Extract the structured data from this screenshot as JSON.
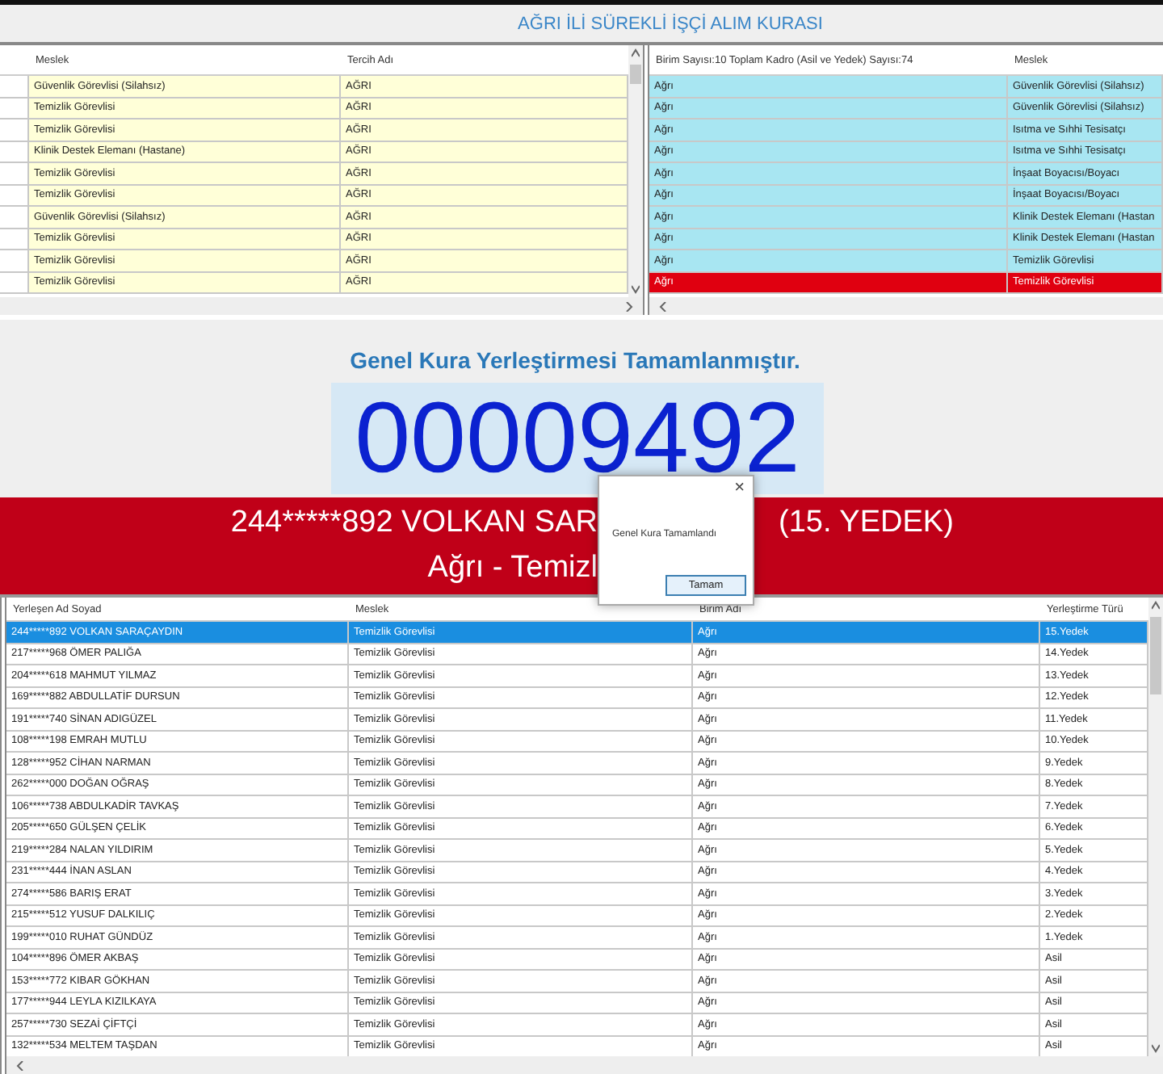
{
  "title": "AĞRI İLİ SÜREKLİ İŞÇİ ALIM KURASI",
  "preference_table": {
    "columns": [
      "Meslek",
      "Tercih Adı"
    ],
    "rows": [
      {
        "meslek": "Güvenlik Görevlisi (Silahsız)",
        "tercih": "AĞRI"
      },
      {
        "meslek": "Temizlik Görevlisi",
        "tercih": "AĞRI"
      },
      {
        "meslek": "Temizlik Görevlisi",
        "tercih": "AĞRI"
      },
      {
        "meslek": "Klinik Destek Elemanı (Hastane)",
        "tercih": "AĞRI"
      },
      {
        "meslek": "Temizlik Görevlisi",
        "tercih": "AĞRI"
      },
      {
        "meslek": "Temizlik Görevlisi",
        "tercih": "AĞRI"
      },
      {
        "meslek": "Güvenlik Görevlisi (Silahsız)",
        "tercih": "AĞRI"
      },
      {
        "meslek": "Temizlik Görevlisi",
        "tercih": "AĞRI"
      },
      {
        "meslek": "Temizlik Görevlisi",
        "tercih": "AĞRI"
      },
      {
        "meslek": "Temizlik Görevlisi",
        "tercih": "AĞRI"
      }
    ]
  },
  "unit_table": {
    "columns": [
      "Birim Sayısı:10 Toplam Kadro (Asil ve Yedek) Sayısı:74",
      "Meslek"
    ],
    "rows": [
      {
        "birim": "Ağrı",
        "meslek": "Güvenlik Görevlisi (Silahsız)",
        "selected": false
      },
      {
        "birim": "Ağrı",
        "meslek": "Güvenlik Görevlisi (Silahsız)",
        "selected": false
      },
      {
        "birim": "Ağrı",
        "meslek": "Isıtma ve Sıhhi Tesisatçı",
        "selected": false
      },
      {
        "birim": "Ağrı",
        "meslek": "Isıtma ve Sıhhi Tesisatçı",
        "selected": false
      },
      {
        "birim": "Ağrı",
        "meslek": "İnşaat Boyacısı/Boyacı",
        "selected": false
      },
      {
        "birim": "Ağrı",
        "meslek": "İnşaat Boyacısı/Boyacı",
        "selected": false
      },
      {
        "birim": "Ağrı",
        "meslek": "Klinik Destek Elemanı (Hastan",
        "selected": false
      },
      {
        "birim": "Ağrı",
        "meslek": "Klinik Destek Elemanı (Hastan",
        "selected": false
      },
      {
        "birim": "Ağrı",
        "meslek": "Temizlik Görevlisi",
        "selected": false
      },
      {
        "birim": "Ağrı",
        "meslek": "Temizlik Görevlisi",
        "selected": true
      }
    ]
  },
  "status_heading": "Genel Kura Yerleştirmesi Tamamlanmıştır.",
  "counter": "00009492",
  "banner": {
    "line_1_left": "244*****892 VOLKAN SAR",
    "line_1_right": "(15. YEDEK)",
    "line_2": "Ağrı - Temizl"
  },
  "dialog": {
    "message": "Genel Kura Tamamlandı",
    "button": "Tamam",
    "close": "×"
  },
  "results_table": {
    "columns": [
      "Yerleşen Ad Soyad",
      "Meslek",
      "Birim Adı",
      "Yerleştirme Türü"
    ],
    "rows": [
      {
        "name": "244*****892 VOLKAN SARAÇAYDIN",
        "meslek": "Temizlik Görevlisi",
        "birim": "Ağrı",
        "type": "15.Yedek",
        "selected": true
      },
      {
        "name": "217*****968 ÖMER PALIĞA",
        "meslek": "Temizlik Görevlisi",
        "birim": "Ağrı",
        "type": "14.Yedek",
        "selected": false
      },
      {
        "name": "204*****618 MAHMUT YILMAZ",
        "meslek": "Temizlik Görevlisi",
        "birim": "Ağrı",
        "type": "13.Yedek",
        "selected": false
      },
      {
        "name": "169*****882 ABDULLATİF DURSUN",
        "meslek": "Temizlik Görevlisi",
        "birim": "Ağrı",
        "type": "12.Yedek",
        "selected": false
      },
      {
        "name": "191*****740 SİNAN ADIGÜZEL",
        "meslek": "Temizlik Görevlisi",
        "birim": "Ağrı",
        "type": "11.Yedek",
        "selected": false
      },
      {
        "name": "108*****198 EMRAH MUTLU",
        "meslek": "Temizlik Görevlisi",
        "birim": "Ağrı",
        "type": "10.Yedek",
        "selected": false
      },
      {
        "name": "128*****952 CİHAN NARMAN",
        "meslek": "Temizlik Görevlisi",
        "birim": "Ağrı",
        "type": "9.Yedek",
        "selected": false
      },
      {
        "name": "262*****000 DOĞAN OĞRAŞ",
        "meslek": "Temizlik Görevlisi",
        "birim": "Ağrı",
        "type": "8.Yedek",
        "selected": false
      },
      {
        "name": "106*****738 ABDULKADİR TAVKAŞ",
        "meslek": "Temizlik Görevlisi",
        "birim": "Ağrı",
        "type": "7.Yedek",
        "selected": false
      },
      {
        "name": "205*****650 GÜLŞEN ÇELİK",
        "meslek": "Temizlik Görevlisi",
        "birim": "Ağrı",
        "type": "6.Yedek",
        "selected": false
      },
      {
        "name": "219*****284 NALAN YILDIRIM",
        "meslek": "Temizlik Görevlisi",
        "birim": "Ağrı",
        "type": "5.Yedek",
        "selected": false
      },
      {
        "name": "231*****444 İNAN ASLAN",
        "meslek": "Temizlik Görevlisi",
        "birim": "Ağrı",
        "type": "4.Yedek",
        "selected": false
      },
      {
        "name": "274*****586 BARIŞ ERAT",
        "meslek": "Temizlik Görevlisi",
        "birim": "Ağrı",
        "type": "3.Yedek",
        "selected": false
      },
      {
        "name": "215*****512 YUSUF DALKILIÇ",
        "meslek": "Temizlik Görevlisi",
        "birim": "Ağrı",
        "type": "2.Yedek",
        "selected": false
      },
      {
        "name": "199*****010 RUHAT GÜNDÜZ",
        "meslek": "Temizlik Görevlisi",
        "birim": "Ağrı",
        "type": "1.Yedek",
        "selected": false
      },
      {
        "name": "104*****896 ÖMER AKBAŞ",
        "meslek": "Temizlik Görevlisi",
        "birim": "Ağrı",
        "type": "Asil",
        "selected": false
      },
      {
        "name": "153*****772 KIBAR GÖKHAN",
        "meslek": "Temizlik Görevlisi",
        "birim": "Ağrı",
        "type": "Asil",
        "selected": false
      },
      {
        "name": "177*****944 LEYLA KIZILKAYA",
        "meslek": "Temizlik Görevlisi",
        "birim": "Ağrı",
        "type": "Asil",
        "selected": false
      },
      {
        "name": "257*****730 SEZAİ ÇİFTÇİ",
        "meslek": "Temizlik Görevlisi",
        "birim": "Ağrı",
        "type": "Asil",
        "selected": false
      },
      {
        "name": "132*****534 MELTEM TAŞDAN",
        "meslek": "Temizlik Görevlisi",
        "birim": "Ağrı",
        "type": "Asil",
        "selected": false
      }
    ]
  }
}
